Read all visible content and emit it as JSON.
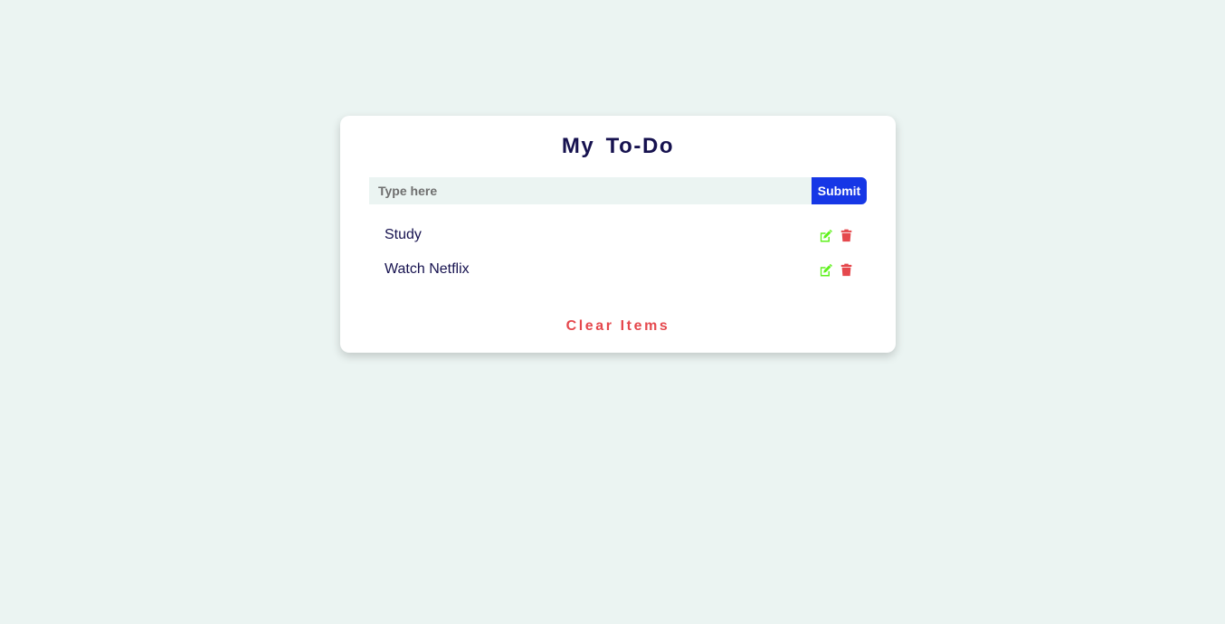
{
  "app": {
    "title": "My To-Do"
  },
  "form": {
    "placeholder": "Type here",
    "value": "",
    "submit_label": "Submit"
  },
  "items": [
    {
      "text": "Study"
    },
    {
      "text": "Watch Netflix"
    }
  ],
  "footer": {
    "clear_label": "Clear Items"
  },
  "icons": {
    "edit": "edit-icon",
    "delete": "trash-icon"
  },
  "colors": {
    "background": "#ebf4f2",
    "card": "#ffffff",
    "title": "#16124f",
    "submit": "#1637e6",
    "edit_icon": "#5ef11b",
    "delete_icon": "#e5484d",
    "clear": "#e5484d"
  }
}
